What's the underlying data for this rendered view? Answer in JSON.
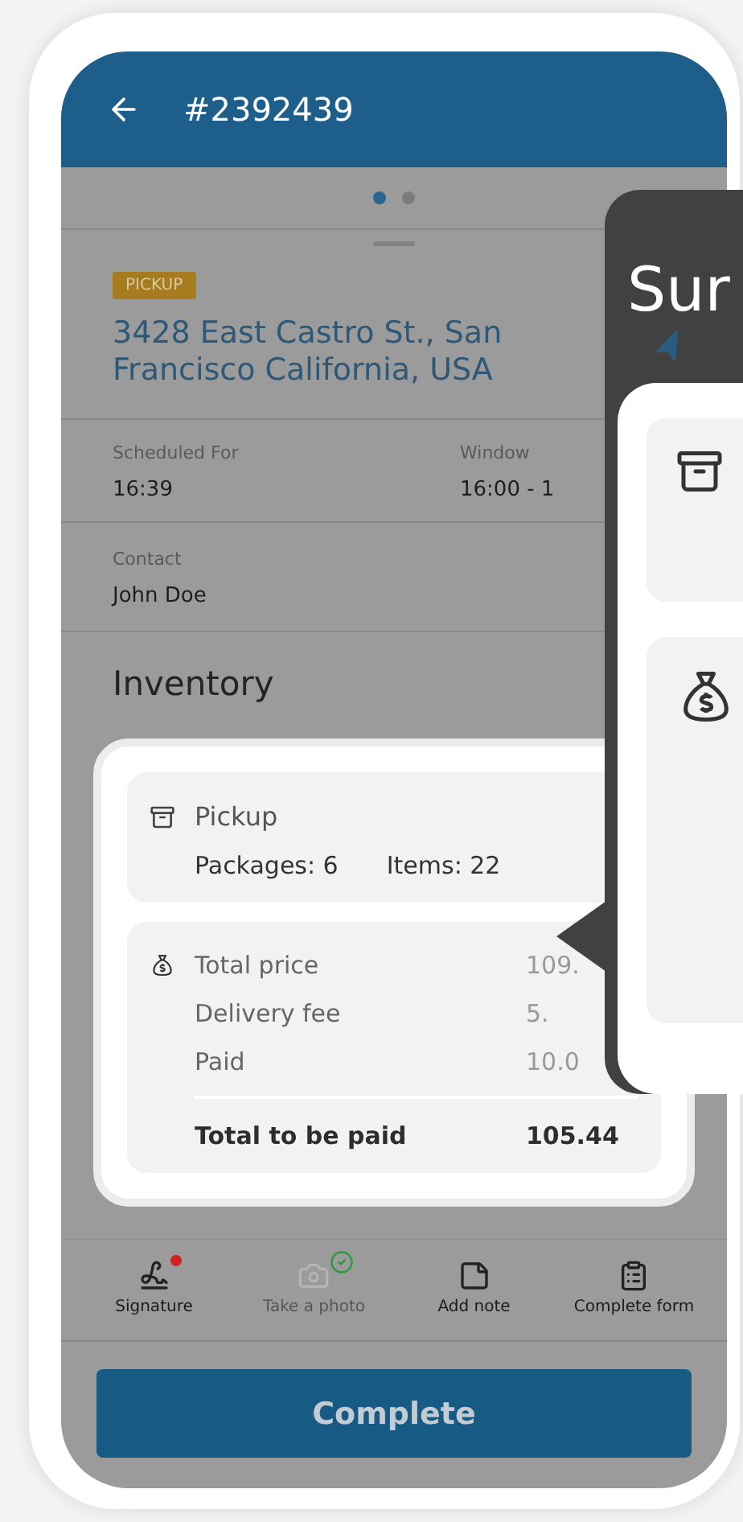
{
  "header": {
    "title": "#2392439"
  },
  "pager": [
    {
      "selected": true
    },
    {
      "selected": false
    }
  ],
  "stop": {
    "badge": "PICKUP",
    "address": "3428 East Castro St., San Francisco California, USA"
  },
  "details": [
    {
      "label": "Scheduled For",
      "value": "16:39"
    },
    {
      "label": "Window",
      "value": "16:00 - 1"
    }
  ],
  "contact": {
    "label": "Contact",
    "value": "John Doe"
  },
  "inventory": {
    "title": "Inventory",
    "pickup": {
      "title": "Pickup",
      "packages": "Packages: 6",
      "items": "Items: 22"
    },
    "price_rows": [
      {
        "label": "Total price",
        "value": "109.",
        "kind": "line"
      },
      {
        "label": "Delivery fee",
        "value": "5.",
        "kind": "line"
      },
      {
        "label": "Paid",
        "value": "10.0",
        "kind": "line"
      },
      {
        "label": "Total to be paid",
        "value": "105.44",
        "kind": "total"
      }
    ]
  },
  "summary_panel": {
    "title": "Sur"
  },
  "actions": [
    {
      "label": "Signature",
      "kind": "signature",
      "disabled": false,
      "needs_attention": true,
      "completed": false
    },
    {
      "label": "Take a photo",
      "kind": "photo",
      "disabled": true,
      "needs_attention": false,
      "completed": true
    },
    {
      "label": "Add note",
      "kind": "note",
      "disabled": false,
      "needs_attention": false,
      "completed": false
    },
    {
      "label": "Complete form",
      "kind": "form",
      "disabled": false,
      "needs_attention": false,
      "completed": false
    }
  ],
  "complete_button": {
    "label": "Complete"
  }
}
